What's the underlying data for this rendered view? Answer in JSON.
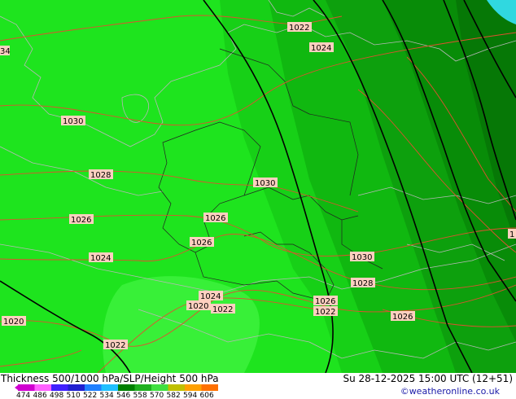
{
  "title": "Thickness 500/1000 hPa/SLP/Height 500 hPa",
  "datetime": "Su 28-12-2025 15:00 UTC (12+51)",
  "credit": "©weatheronline.co.uk",
  "legend": {
    "values": [
      "474",
      "486",
      "498",
      "510",
      "522",
      "534",
      "546",
      "558",
      "570",
      "582",
      "594",
      "606"
    ],
    "colors": [
      "#d000d0",
      "#ff60ff",
      "#4020ff",
      "#2020d0",
      "#2080ff",
      "#20c0ff",
      "#008000",
      "#20b020",
      "#40e040",
      "#c0c000",
      "#ffa000",
      "#ff7000"
    ]
  },
  "isobars": [
    {
      "label": "1022",
      "name": "isobar-label-1022-a"
    },
    {
      "label": "1024",
      "name": "isobar-label-1024-a"
    },
    {
      "label": "34",
      "name": "isobar-label-34"
    },
    {
      "label": "1030",
      "name": "isobar-label-1030-a"
    },
    {
      "label": "1028",
      "name": "isobar-label-1028-a"
    },
    {
      "label": "1030",
      "name": "isobar-label-1030-b"
    },
    {
      "label": "1026",
      "name": "isobar-label-1026-a"
    },
    {
      "label": "1026",
      "name": "isobar-label-1026-b"
    },
    {
      "label": "1026",
      "name": "isobar-label-1026-c"
    },
    {
      "label": "1024",
      "name": "isobar-label-1024-b"
    },
    {
      "label": "1030",
      "name": "isobar-label-1030-c"
    },
    {
      "label": "1028",
      "name": "isobar-label-1028-b"
    },
    {
      "label": "1024",
      "name": "isobar-label-1024-c"
    },
    {
      "label": "1020",
      "name": "isobar-label-1020-a"
    },
    {
      "label": "1022",
      "name": "isobar-label-1022-b"
    },
    {
      "label": "1026",
      "name": "isobar-label-1026-d"
    },
    {
      "label": "1022",
      "name": "isobar-label-1022-c"
    },
    {
      "label": "1026",
      "name": "isobar-label-1026-e"
    },
    {
      "label": "1020",
      "name": "isobar-label-1020-b"
    },
    {
      "label": "1022",
      "name": "isobar-label-1022-d"
    },
    {
      "label": "1",
      "name": "isobar-label-edge"
    }
  ]
}
